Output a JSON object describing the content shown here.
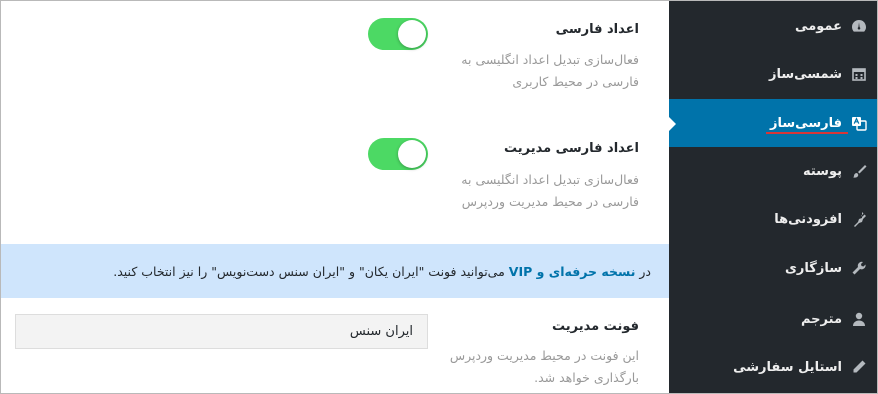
{
  "sidebar": {
    "items": [
      {
        "label": "عمومی",
        "icon": "gauge-icon"
      },
      {
        "label": "شمسی‌ساز",
        "icon": "calendar-icon"
      },
      {
        "label": "فارسی‌ساز",
        "icon": "translate-icon",
        "active": true
      },
      {
        "label": "پوسته",
        "icon": "brush-icon"
      },
      {
        "label": "افزودنی‌ها",
        "icon": "plugin-icon"
      },
      {
        "label": "سازگاری",
        "icon": "wrench-icon"
      },
      {
        "label": "مترجم",
        "icon": "person-icon"
      },
      {
        "label": "استایل سفارشی",
        "icon": "pencil-icon"
      }
    ]
  },
  "settings": {
    "persian_numbers": {
      "title": "اعداد فارسی",
      "desc": "فعال‌سازی تبدیل اعداد انگلیسی به فارسی در محیط کاربری",
      "enabled": true
    },
    "admin_persian_numbers": {
      "title": "اعداد فارسی مدیریت",
      "desc": "فعال‌سازی تبدیل اعداد انگلیسی به فارسی در محیط مدیریت وردپرس",
      "enabled": true
    },
    "notice": {
      "prefix": "در",
      "highlight": "نسخه حرفه‌ای و VIP",
      "rest": "می‌توانید فونت \"ایران یکان\" و \"ایران سنس دست‌نویس\" را نیز انتخاب کنید."
    },
    "admin_font": {
      "title": "فونت مدیریت",
      "value": "ایران سنس",
      "desc": "این فونت در محیط مدیریت وردپرس بارگذاری خواهد شد."
    }
  },
  "colors": {
    "sidebar_bg": "#23282d",
    "active_bg": "#0073aa",
    "toggle_on": "#4cd964",
    "notice_bg": "#cfe5fc"
  }
}
